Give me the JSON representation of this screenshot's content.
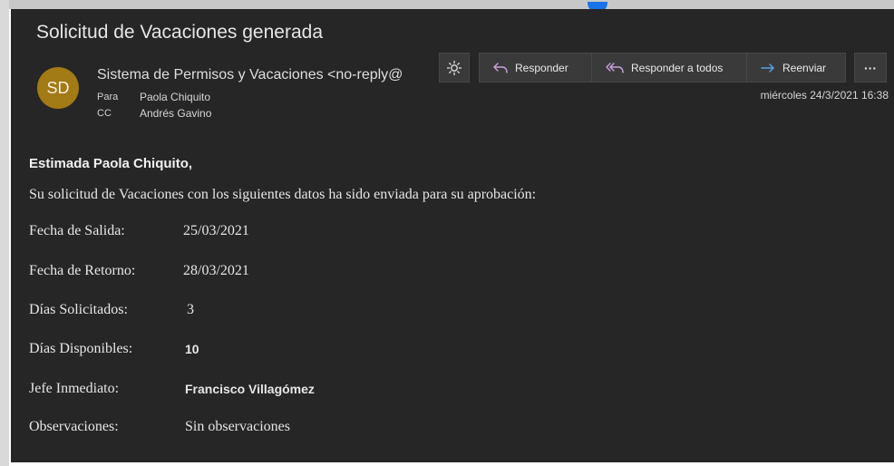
{
  "message": {
    "subject": "Solicitud de Vacaciones generada",
    "avatar_initials": "SD",
    "avatar_color": "#a27a16",
    "sender": "Sistema de Permisos y Vacaciones <no-reply@",
    "to_label": "Para",
    "to_value": "Paola Chiquito",
    "cc_label": "CC",
    "cc_value": "Andrés Gavino",
    "date": "miércoles 24/3/2021 16:38"
  },
  "toolbar": {
    "brightness_icon": "sun-icon",
    "reply_label": "Responder",
    "reply_all_label": "Responder a todos",
    "forward_label": "Reenviar",
    "more_label": "···"
  },
  "body": {
    "greeting": "Estimada Paola Chiquito,",
    "intro": "Su solicitud de Vacaciones con los siguientes datos ha sido enviada para su aprobación:",
    "fields": [
      {
        "label": "Fecha de Salida:",
        "value": "25/03/2021"
      },
      {
        "label": "Fecha de Retorno:",
        "value": "28/03/2021"
      },
      {
        "label": "Días Solicitados:",
        "value": "3"
      },
      {
        "label": "Días Disponibles:",
        "value": "10"
      },
      {
        "label": "Jefe Inmediato:",
        "value": "Francisco Villagómez"
      },
      {
        "label": "Observaciones:",
        "value": "Sin observaciones"
      }
    ]
  },
  "colors": {
    "background": "#262626",
    "button": "#3a3a3a",
    "reply_icon": "#c9a0dc",
    "forward_icon": "#5aa0e6",
    "indicator": "#1a73e8"
  }
}
